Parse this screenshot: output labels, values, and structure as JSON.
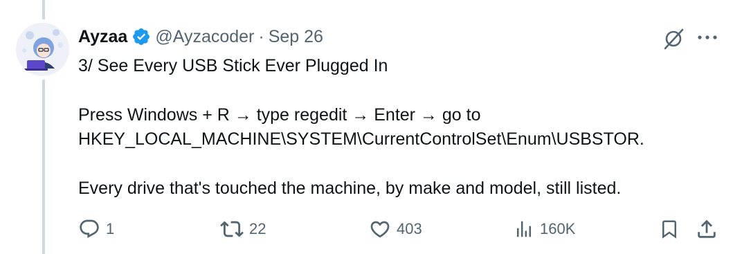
{
  "author": {
    "display_name": "Ayzaa",
    "handle": "@Ayzacoder",
    "separator": "·",
    "date": "Sep 26",
    "verified": true,
    "verified_color": "#1d9bf0"
  },
  "tweet": {
    "lines": [
      "3/ See Every USB Stick Ever Plugged In",
      "Press Windows + R → type regedit → Enter → go to",
      "HKEY_LOCAL_MACHINE\\SYSTEM\\CurrentControlSet\\Enum\\USBSTOR.",
      "Every drive that's touched the machine, by make and model, still listed."
    ]
  },
  "actions": {
    "reply_count": "1",
    "retweet_count": "22",
    "like_count": "403",
    "views_count": "160K"
  },
  "icons": {
    "reply": "reply-icon",
    "retweet": "retweet-icon",
    "like": "heart-icon",
    "views": "views-icon",
    "bookmark": "bookmark-icon",
    "share": "share-icon",
    "grok": "grok-icon",
    "more": "more-icon"
  },
  "colors": {
    "text": "#0f1419",
    "secondary": "#536471",
    "thread_line": "#cfd9de"
  }
}
